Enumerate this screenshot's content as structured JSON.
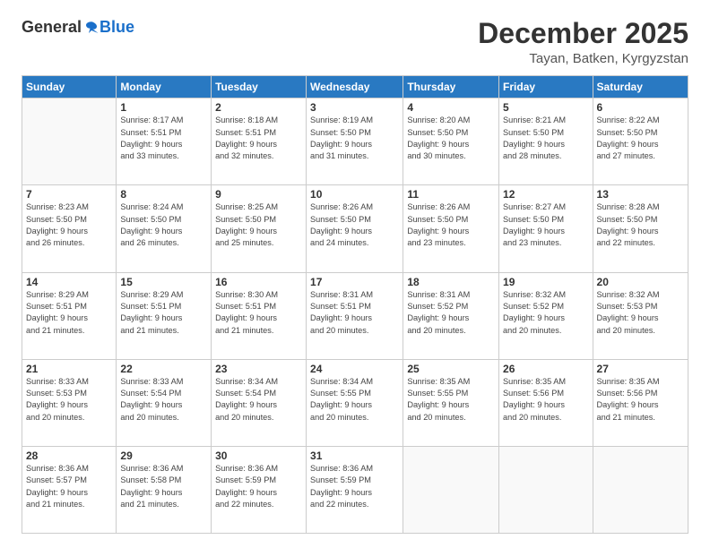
{
  "logo": {
    "general": "General",
    "blue": "Blue"
  },
  "header": {
    "month": "December 2025",
    "location": "Tayan, Batken, Kyrgyzstan"
  },
  "days_of_week": [
    "Sunday",
    "Monday",
    "Tuesday",
    "Wednesday",
    "Thursday",
    "Friday",
    "Saturday"
  ],
  "weeks": [
    [
      {
        "day": "",
        "info": ""
      },
      {
        "day": "1",
        "info": "Sunrise: 8:17 AM\nSunset: 5:51 PM\nDaylight: 9 hours\nand 33 minutes."
      },
      {
        "day": "2",
        "info": "Sunrise: 8:18 AM\nSunset: 5:51 PM\nDaylight: 9 hours\nand 32 minutes."
      },
      {
        "day": "3",
        "info": "Sunrise: 8:19 AM\nSunset: 5:50 PM\nDaylight: 9 hours\nand 31 minutes."
      },
      {
        "day": "4",
        "info": "Sunrise: 8:20 AM\nSunset: 5:50 PM\nDaylight: 9 hours\nand 30 minutes."
      },
      {
        "day": "5",
        "info": "Sunrise: 8:21 AM\nSunset: 5:50 PM\nDaylight: 9 hours\nand 28 minutes."
      },
      {
        "day": "6",
        "info": "Sunrise: 8:22 AM\nSunset: 5:50 PM\nDaylight: 9 hours\nand 27 minutes."
      }
    ],
    [
      {
        "day": "7",
        "info": "Sunrise: 8:23 AM\nSunset: 5:50 PM\nDaylight: 9 hours\nand 26 minutes."
      },
      {
        "day": "8",
        "info": "Sunrise: 8:24 AM\nSunset: 5:50 PM\nDaylight: 9 hours\nand 26 minutes."
      },
      {
        "day": "9",
        "info": "Sunrise: 8:25 AM\nSunset: 5:50 PM\nDaylight: 9 hours\nand 25 minutes."
      },
      {
        "day": "10",
        "info": "Sunrise: 8:26 AM\nSunset: 5:50 PM\nDaylight: 9 hours\nand 24 minutes."
      },
      {
        "day": "11",
        "info": "Sunrise: 8:26 AM\nSunset: 5:50 PM\nDaylight: 9 hours\nand 23 minutes."
      },
      {
        "day": "12",
        "info": "Sunrise: 8:27 AM\nSunset: 5:50 PM\nDaylight: 9 hours\nand 23 minutes."
      },
      {
        "day": "13",
        "info": "Sunrise: 8:28 AM\nSunset: 5:50 PM\nDaylight: 9 hours\nand 22 minutes."
      }
    ],
    [
      {
        "day": "14",
        "info": "Sunrise: 8:29 AM\nSunset: 5:51 PM\nDaylight: 9 hours\nand 21 minutes."
      },
      {
        "day": "15",
        "info": "Sunrise: 8:29 AM\nSunset: 5:51 PM\nDaylight: 9 hours\nand 21 minutes."
      },
      {
        "day": "16",
        "info": "Sunrise: 8:30 AM\nSunset: 5:51 PM\nDaylight: 9 hours\nand 21 minutes."
      },
      {
        "day": "17",
        "info": "Sunrise: 8:31 AM\nSunset: 5:51 PM\nDaylight: 9 hours\nand 20 minutes."
      },
      {
        "day": "18",
        "info": "Sunrise: 8:31 AM\nSunset: 5:52 PM\nDaylight: 9 hours\nand 20 minutes."
      },
      {
        "day": "19",
        "info": "Sunrise: 8:32 AM\nSunset: 5:52 PM\nDaylight: 9 hours\nand 20 minutes."
      },
      {
        "day": "20",
        "info": "Sunrise: 8:32 AM\nSunset: 5:53 PM\nDaylight: 9 hours\nand 20 minutes."
      }
    ],
    [
      {
        "day": "21",
        "info": "Sunrise: 8:33 AM\nSunset: 5:53 PM\nDaylight: 9 hours\nand 20 minutes."
      },
      {
        "day": "22",
        "info": "Sunrise: 8:33 AM\nSunset: 5:54 PM\nDaylight: 9 hours\nand 20 minutes."
      },
      {
        "day": "23",
        "info": "Sunrise: 8:34 AM\nSunset: 5:54 PM\nDaylight: 9 hours\nand 20 minutes."
      },
      {
        "day": "24",
        "info": "Sunrise: 8:34 AM\nSunset: 5:55 PM\nDaylight: 9 hours\nand 20 minutes."
      },
      {
        "day": "25",
        "info": "Sunrise: 8:35 AM\nSunset: 5:55 PM\nDaylight: 9 hours\nand 20 minutes."
      },
      {
        "day": "26",
        "info": "Sunrise: 8:35 AM\nSunset: 5:56 PM\nDaylight: 9 hours\nand 20 minutes."
      },
      {
        "day": "27",
        "info": "Sunrise: 8:35 AM\nSunset: 5:56 PM\nDaylight: 9 hours\nand 21 minutes."
      }
    ],
    [
      {
        "day": "28",
        "info": "Sunrise: 8:36 AM\nSunset: 5:57 PM\nDaylight: 9 hours\nand 21 minutes."
      },
      {
        "day": "29",
        "info": "Sunrise: 8:36 AM\nSunset: 5:58 PM\nDaylight: 9 hours\nand 21 minutes."
      },
      {
        "day": "30",
        "info": "Sunrise: 8:36 AM\nSunset: 5:59 PM\nDaylight: 9 hours\nand 22 minutes."
      },
      {
        "day": "31",
        "info": "Sunrise: 8:36 AM\nSunset: 5:59 PM\nDaylight: 9 hours\nand 22 minutes."
      },
      {
        "day": "",
        "info": ""
      },
      {
        "day": "",
        "info": ""
      },
      {
        "day": "",
        "info": ""
      }
    ]
  ]
}
